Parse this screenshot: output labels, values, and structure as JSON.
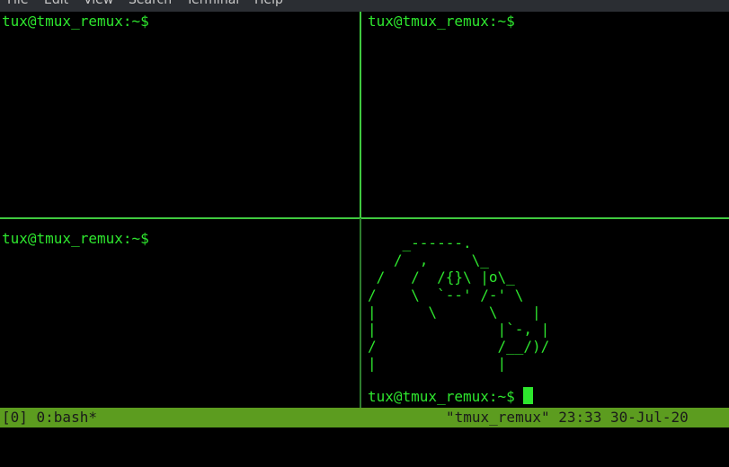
{
  "menubar": {
    "items": [
      "File",
      "Edit",
      "View",
      "Search",
      "Terminal",
      "Help"
    ]
  },
  "panes": {
    "top_left": {
      "prompt": "tux@tmux_remux:~$"
    },
    "top_right": {
      "prompt": "tux@tmux_remux:~$"
    },
    "bottom_left": {
      "prompt": "tux@tmux_remux:~$"
    },
    "bottom_right": {
      "ascii_art": "    _------.\n   /  ,     \\_\n /   /  /{}\\ |o\\_\n/    \\  `--' /-' \\\n|      \\      \\    |\n|              |`-, |\n/              /__/)/\n|              |",
      "prompt": "tux@tmux_remux:~$ "
    }
  },
  "statusbar": {
    "left": "[0] 0:bash*",
    "right": "\"tmux_remux\" 23:33 30-Jul-20"
  },
  "colors": {
    "terminal_bg": "#000000",
    "text_green": "#2ee62e",
    "divider_green": "#3fc93f",
    "status_bg": "#5c9c1f"
  }
}
